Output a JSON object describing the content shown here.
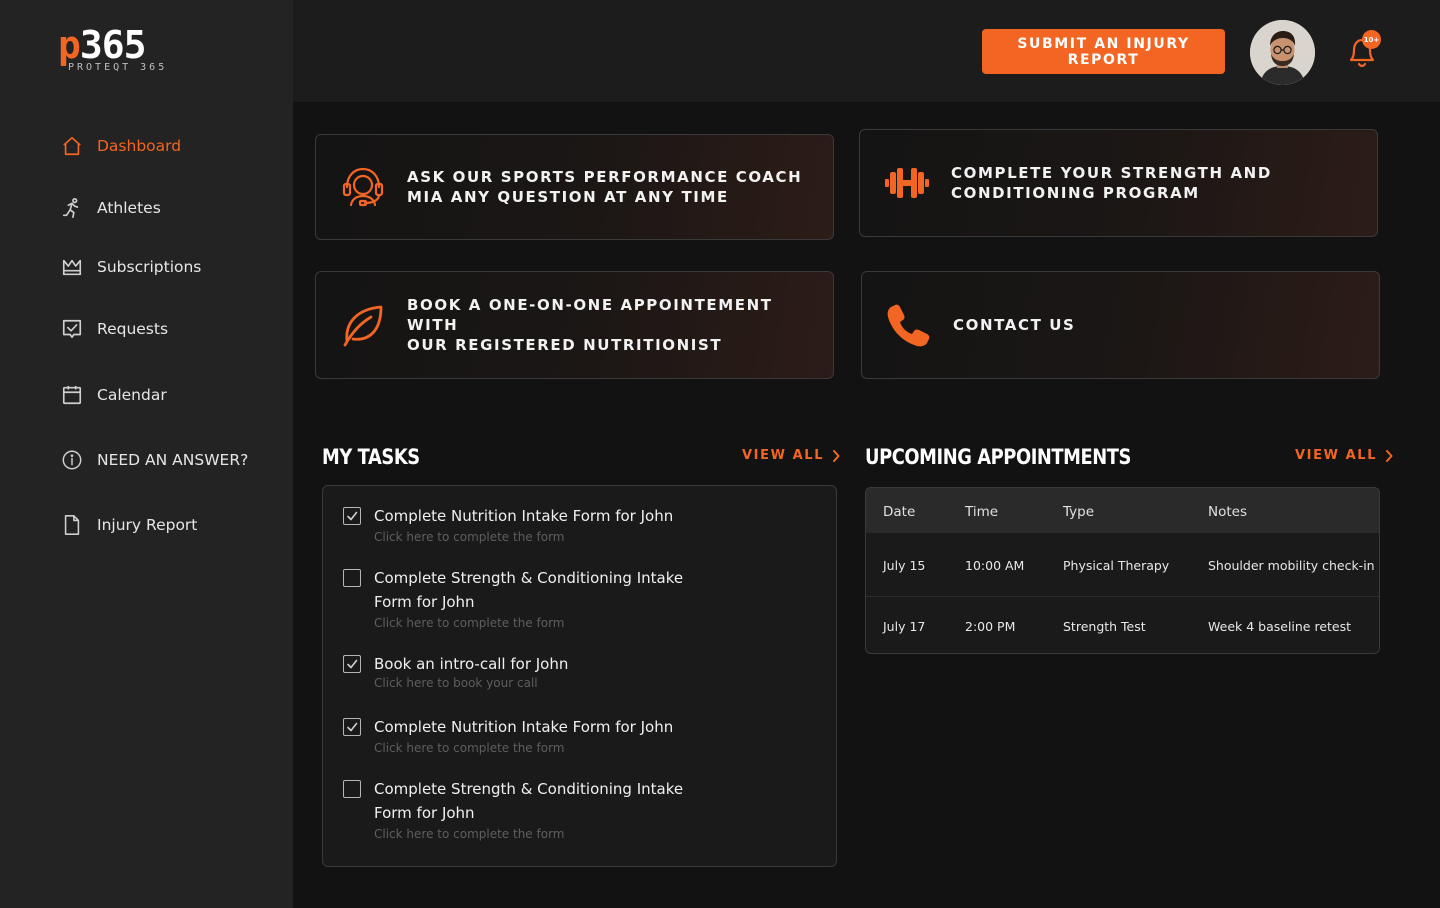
{
  "brand": {
    "logo_text": "P365",
    "logo_sub": "PROTEQT 365",
    "accent": "#f26522"
  },
  "sidebar": {
    "items": [
      {
        "label": "Dashboard",
        "icon": "home-icon",
        "active": true
      },
      {
        "label": "Athletes",
        "icon": "runner-icon"
      },
      {
        "label": "Subscriptions",
        "icon": "crown-icon"
      },
      {
        "label": "Requests",
        "icon": "checkbox-icon"
      },
      {
        "label": "Calendar",
        "icon": "calendar-icon"
      },
      {
        "label": "NEED AN ANSWER?",
        "icon": "info-icon"
      },
      {
        "label": "Injury Report",
        "icon": "document-icon"
      }
    ]
  },
  "topbar": {
    "submit_label": "SUBMIT AN INJURY REPORT",
    "notification_badge": "10+"
  },
  "cards": [
    {
      "text": "ASK OUR SPORTS PERFORMANCE COACH\nMIA ANY QUESTION AT ANY TIME",
      "icon": "headset-icon"
    },
    {
      "text": "COMPLETE YOUR STRENGTH AND\nCONDITIONING PROGRAM",
      "icon": "dumbbell-icon"
    },
    {
      "text": "BOOK A ONE-ON-ONE APPOINTEMENT WITH\nOUR REGISTERED NUTRITIONIST",
      "icon": "leaf-icon"
    },
    {
      "text": "CONTACT US",
      "icon": "phone-icon"
    }
  ],
  "tasks": {
    "title": "MY TASKS",
    "view_all": "VIEW ALL",
    "items": [
      {
        "title": "Complete Nutrition Intake Form for John",
        "sub": "Click here to complete the form",
        "checked": true
      },
      {
        "title": "Complete Strength & Conditioning Intake Form for John",
        "sub": "Click here to complete the form",
        "checked": false
      },
      {
        "title": "Book an intro-call for John",
        "sub": "Click here to book your call",
        "checked": true
      },
      {
        "title": "Complete Nutrition Intake Form for John",
        "sub": "Click here to complete the form",
        "checked": true
      },
      {
        "title": "Complete Strength & Conditioning Intake Form for John",
        "sub": "Click here to complete the form",
        "checked": false
      }
    ]
  },
  "appointments": {
    "title": "UPCOMING APPOINTMENTS",
    "view_all": "VIEW ALL",
    "columns": [
      "Date",
      "Time",
      "Type",
      "Notes"
    ],
    "rows": [
      [
        "July 15",
        "10:00 AM",
        "Physical Therapy",
        "Shoulder mobility check-in"
      ],
      [
        "July 17",
        "2:00 PM",
        "Strength Test",
        "Week 4 baseline retest"
      ]
    ]
  }
}
